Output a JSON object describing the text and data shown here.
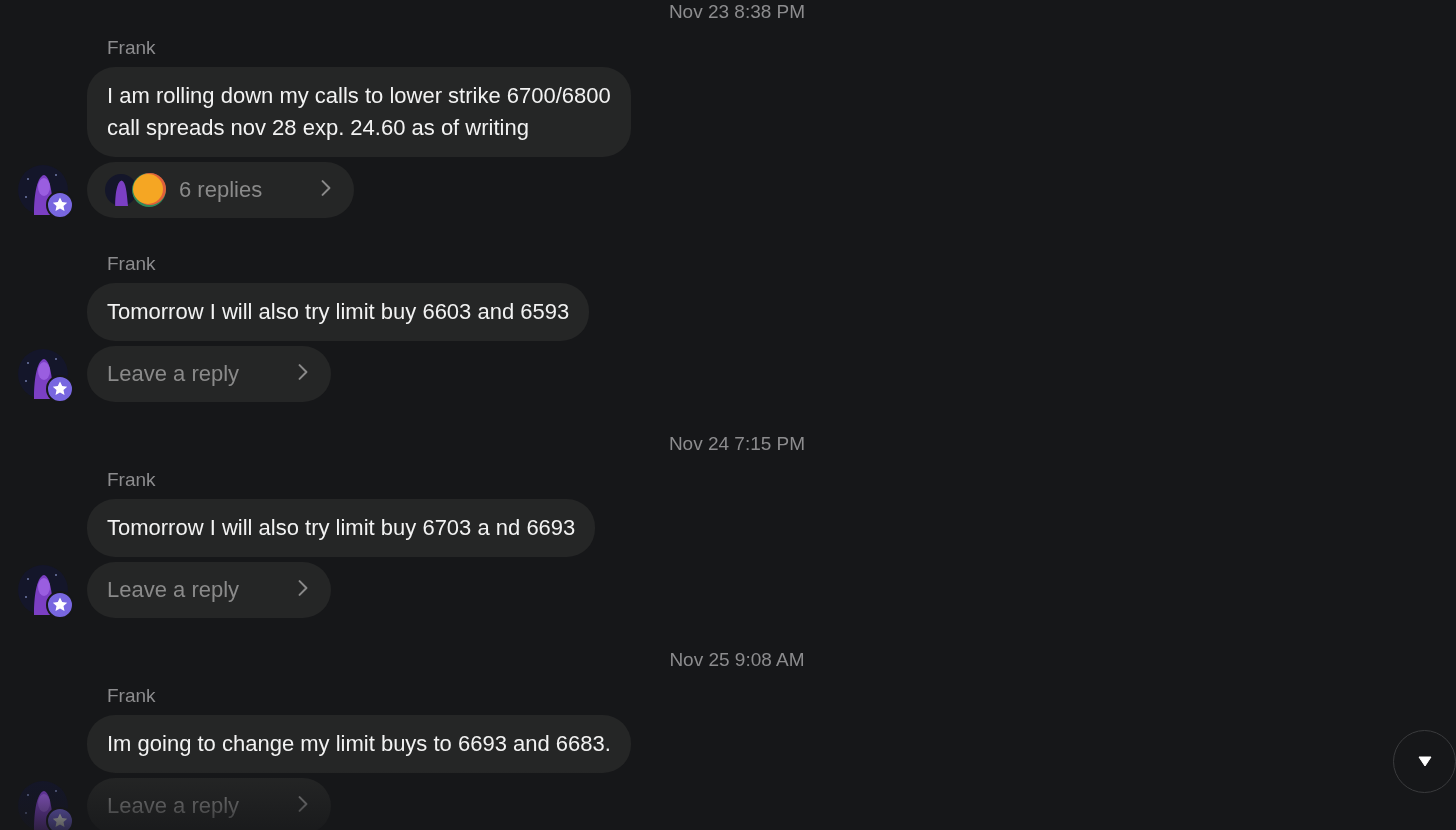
{
  "feed": [
    {
      "kind": "date",
      "text": "Nov 23 8:38 PM"
    },
    {
      "kind": "message",
      "author": "Frank",
      "lines": [
        "I am rolling down my calls to lower strike 6700/6800",
        "call spreads nov 28 exp. 24.60 as of writing"
      ],
      "thread": {
        "kind": "replies",
        "label": "6 replies"
      }
    },
    {
      "kind": "message",
      "author": "Frank",
      "lines": [
        "Tomorrow I will also try limit buy 6603 and 6593"
      ],
      "thread": {
        "kind": "prompt",
        "placeholder": "Leave a reply"
      }
    },
    {
      "kind": "date",
      "text": "Nov 24 7:15 PM"
    },
    {
      "kind": "message",
      "author": "Frank",
      "lines": [
        "Tomorrow I will also try limit buy 6703 a nd 6693"
      ],
      "thread": {
        "kind": "prompt",
        "placeholder": "Leave a reply"
      }
    },
    {
      "kind": "date",
      "text": "Nov 25 9:08 AM"
    },
    {
      "kind": "message",
      "author": "Frank",
      "lines": [
        "Im going to change my limit buys to 6693 and 6683."
      ],
      "thread": {
        "kind": "prompt",
        "placeholder": "Leave a reply"
      }
    }
  ]
}
